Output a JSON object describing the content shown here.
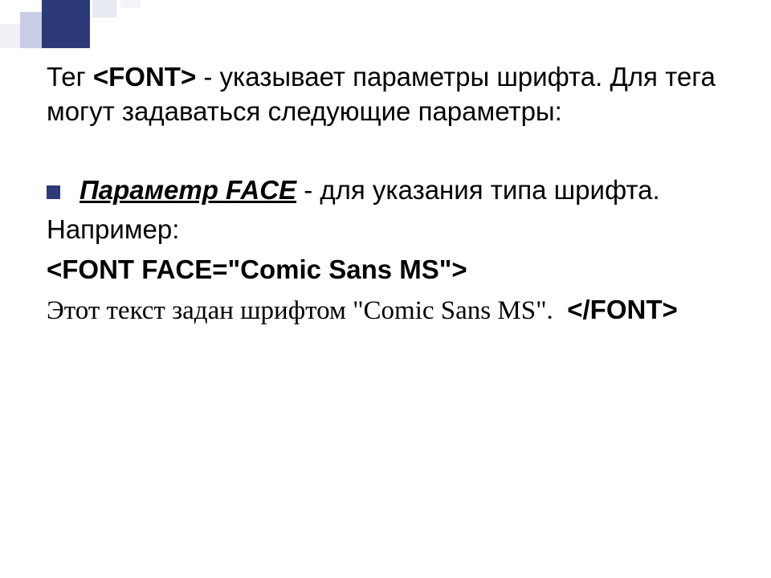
{
  "intro": {
    "prefix": "Тег ",
    "tag": "<FONT>",
    "suffix": " - указывает параметры шрифта. Для тега могут задаваться следующие параметры:"
  },
  "bullet": {
    "param": "Параметр FACE",
    "rest": " - для указания типа шрифта."
  },
  "example_label": "Например:",
  "open_tag": "<FONT FACE=\"Comic Sans MS\">",
  "comic_text": "Этот текст задан шрифтом \"Comic Sans MS\". ",
  "close_tag": "</FONT>"
}
